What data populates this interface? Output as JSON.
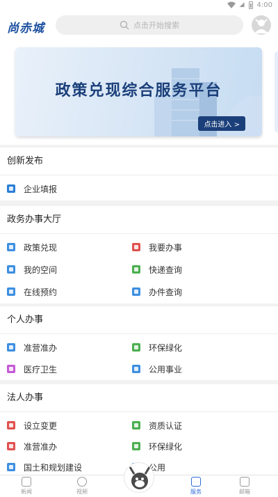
{
  "status_bar": {
    "time": "4:00"
  },
  "header": {
    "logo": "尚赤城",
    "search_placeholder": "点击开始搜索"
  },
  "banner": {
    "title": "政策兑现综合服务平台",
    "cta": "点击进入 >"
  },
  "sections": [
    {
      "title": "创新发布",
      "items": [
        {
          "label": "企业填报",
          "icon": "form-icon",
          "color": "#2a7fd6"
        }
      ]
    },
    {
      "title": "政务办事大厅",
      "items": [
        {
          "label": "政策兑现",
          "icon": "document-icon",
          "color": "#3d8fe0"
        },
        {
          "label": "我要办事",
          "icon": "document-red-icon",
          "color": "#e0514f"
        },
        {
          "label": "我的空间",
          "icon": "user-icon",
          "color": "#3d8fe0"
        },
        {
          "label": "快递查询",
          "icon": "express-icon",
          "color": "#4caf50"
        },
        {
          "label": "在线预约",
          "icon": "calendar-icon",
          "color": "#3d8fe0"
        },
        {
          "label": "办件查询",
          "icon": "query-icon",
          "color": "#3d8fe0"
        }
      ]
    },
    {
      "title": "个人办事",
      "items": [
        {
          "label": "准营准办",
          "icon": "license-icon",
          "color": "#3d8fe0"
        },
        {
          "label": "环保绿化",
          "icon": "shield-icon",
          "color": "#4caf50"
        },
        {
          "label": "医疗卫生",
          "icon": "medical-icon",
          "color": "#c45ad6"
        },
        {
          "label": "公用事业",
          "icon": "building-icon",
          "color": "#3d8fe0"
        }
      ]
    },
    {
      "title": "法人办事",
      "items": [
        {
          "label": "设立变更",
          "icon": "change-icon",
          "color": "#e0514f"
        },
        {
          "label": "资质认证",
          "icon": "certificate-icon",
          "color": "#4caf50"
        },
        {
          "label": "准营准办",
          "icon": "license-red-icon",
          "color": "#e0514f"
        },
        {
          "label": "环保绿化",
          "icon": "shield-icon",
          "color": "#4caf50"
        },
        {
          "label": "国土和规划建设",
          "icon": "land-icon",
          "color": "#3d8fe0"
        },
        {
          "label": "公用",
          "icon": "building-icon",
          "color": "#3d8fe0"
        }
      ]
    }
  ],
  "tabbar": {
    "tabs": [
      {
        "label": "新闻"
      },
      {
        "label": "视频"
      },
      {
        "label": "服务"
      },
      {
        "label": "邮箱"
      }
    ]
  },
  "colors": {
    "accent": "#2f6bd8",
    "banner_text": "#1b3f7a",
    "logo": "#1d4fa0"
  }
}
